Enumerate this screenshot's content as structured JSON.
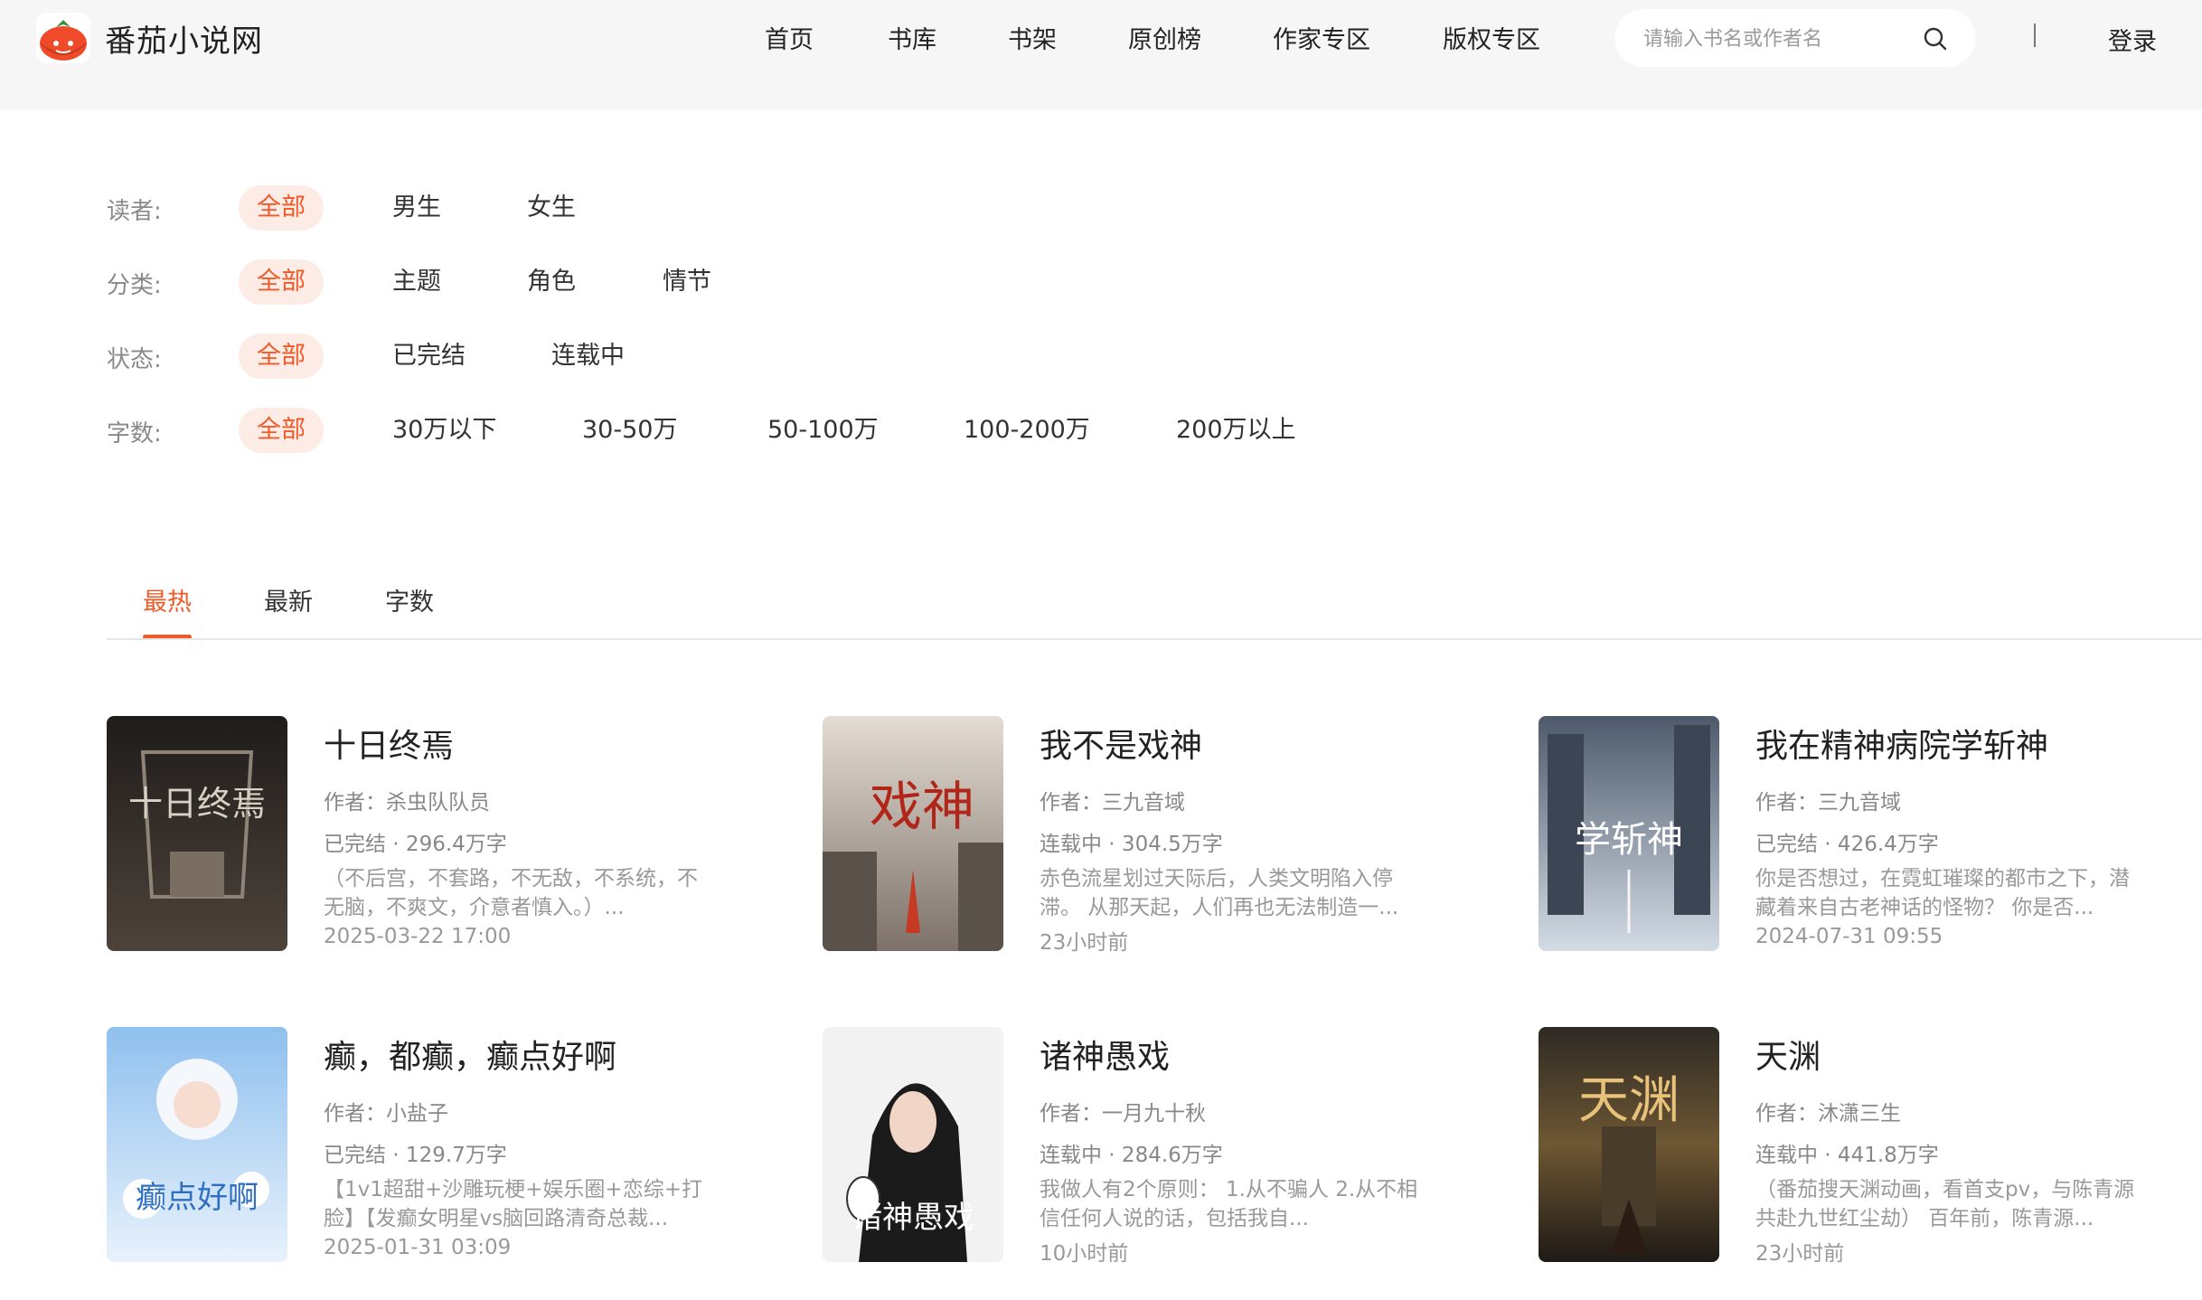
{
  "header": {
    "site_name": "番茄小说网",
    "nav": [
      "首页",
      "书库",
      "书架",
      "原创榜",
      "作家专区",
      "版权专区"
    ],
    "search_placeholder": "请输入书名或作者名",
    "login": "登录"
  },
  "filters": {
    "reader": {
      "label": "读者:",
      "options": [
        "全部",
        "男生",
        "女生"
      ],
      "selected": "全部"
    },
    "category": {
      "label": "分类:",
      "options": [
        "全部",
        "主题",
        "角色",
        "情节"
      ],
      "selected": "全部"
    },
    "status": {
      "label": "状态:",
      "options": [
        "全部",
        "已完结",
        "连载中"
      ],
      "selected": "全部"
    },
    "word_count": {
      "label": "字数:",
      "options": [
        "全部",
        "30万以下",
        "30-50万",
        "50-100万",
        "100-200万",
        "200万以上"
      ],
      "selected": "全部"
    }
  },
  "sort_tabs": {
    "items": [
      "最热",
      "最新",
      "字数"
    ],
    "active": "最热"
  },
  "books": [
    {
      "title": "十日终焉",
      "author": "作者：杀虫队队员",
      "status": "已完结 · 296.4万字",
      "desc": "（不后宫，不套路，不无敌，不系统，不无脑，不爽文，介意者慎入。）...",
      "time": "2025-03-22 17:00",
      "cover_text": "十日终焉",
      "cover_colors": [
        "#2a2623",
        "#5a4f46"
      ]
    },
    {
      "title": "我不是戏神",
      "author": "作者：三九音域",
      "status": "连载中 · 304.5万字",
      "desc": "赤色流星划过天际后，人类文明陷入停滞。 从那天起，人们再也无法制造一...",
      "time": "23小时前",
      "cover_text": "戏神",
      "cover_colors": [
        "#d8d2c8",
        "#8c8076"
      ]
    },
    {
      "title": "我在精神病院学斩神",
      "author": "作者：三九音域",
      "status": "已完结 · 426.4万字",
      "desc": "你是否想过，在霓虹璀璨的都市之下，潜藏着来自古老神话的怪物？ 你是否...",
      "time": "2024-07-31 09:55",
      "cover_text": "学斩神",
      "cover_colors": [
        "#5f6d80",
        "#c9d2de"
      ]
    },
    {
      "title": "癫，都癫，癫点好啊",
      "author": "作者：小盐子",
      "status": "已完结 · 129.7万字",
      "desc": "【1v1超甜+沙雕玩梗+娱乐圈+恋综+打脸】【发癫女明星vs脑回路清奇总裁...",
      "time": "2025-01-31 03:09",
      "cover_text": "癫点好啊",
      "cover_colors": [
        "#7fb2e6",
        "#dbeafa"
      ]
    },
    {
      "title": "诸神愚戏",
      "author": "作者：一月九十秋",
      "status": "连载中 · 284.6万字",
      "desc": "我做人有2个原则： 1.从不骗人 2.从不相信任何人说的话，包括我自...",
      "time": "10小时前",
      "cover_text": "诸神愚戏",
      "cover_colors": [
        "#f0f0f0",
        "#222222"
      ]
    },
    {
      "title": "天渊",
      "author": "作者：沐潇三生",
      "status": "连载中 · 441.8万字",
      "desc": "（番茄搜天渊动画，看首支pv，与陈青源共赴九世红尘劫） 百年前，陈青源...",
      "time": "23小时前",
      "cover_text": "天渊",
      "cover_colors": [
        "#3a3028",
        "#8a6a3a"
      ]
    }
  ],
  "colors": {
    "accent": "#f05a28",
    "chip_bg": "#fdebe6",
    "header_bg": "#f6f6f6"
  }
}
